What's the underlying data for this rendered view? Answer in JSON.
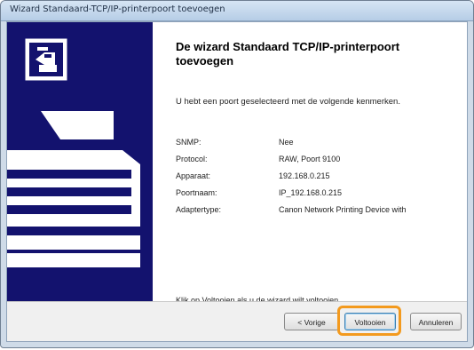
{
  "window": {
    "title": "Wizard Standaard-TCP/IP-printerpoort toevoegen"
  },
  "wizard": {
    "heading": "De wizard Standaard TCP/IP-printerpoort toevoegen",
    "intro": "U hebt een poort geselecteerd met de volgende kenmerken.",
    "properties": [
      {
        "label": "SNMP:",
        "value": "Nee"
      },
      {
        "label": "Protocol:",
        "value": "RAW, Poort 9100"
      },
      {
        "label": "Apparaat:",
        "value": "192.168.0.215"
      },
      {
        "label": "Poortnaam:",
        "value": "IP_192.168.0.215"
      },
      {
        "label": "Adaptertype:",
        "value": "Canon Network Printing Device with"
      }
    ],
    "finish_text": "Klik op Voltooien als u de wizard wilt voltooien."
  },
  "buttons": {
    "back_label": "< Vorige",
    "finish_label": "Voltooien",
    "cancel_label": "Annuleren"
  },
  "colors": {
    "side_panel": "#13126e",
    "highlight": "#f39a1e"
  }
}
